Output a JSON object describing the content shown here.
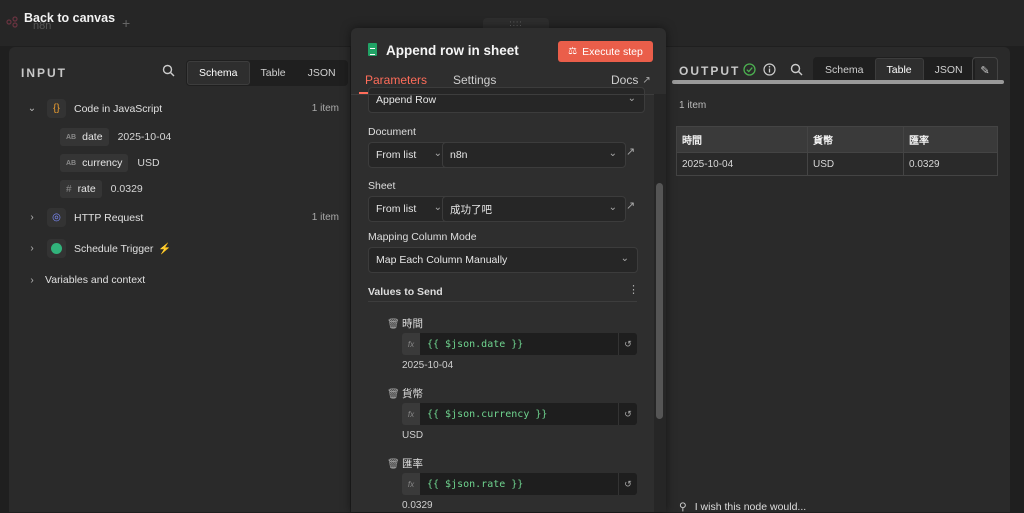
{
  "topbar": {
    "back_label": "Back to canvas",
    "ghost_app_name": "n8n",
    "add_tab_icon": "plus-icon"
  },
  "input": {
    "title": "INPUT",
    "view_tabs": [
      "Schema",
      "Table",
      "JSON"
    ],
    "active_tab": "Schema",
    "nodes": [
      {
        "name": "Code in JavaScript",
        "count": "1 item",
        "icon": "code-braces-icon",
        "expanded": true,
        "fields": [
          {
            "type": "AB",
            "key": "date",
            "value": "2025-10-04"
          },
          {
            "type": "AB",
            "key": "currency",
            "value": "USD"
          },
          {
            "type": "#",
            "key": "rate",
            "value": "0.0329"
          }
        ]
      },
      {
        "name": "HTTP Request",
        "count": "1 item",
        "icon": "globe-icon"
      },
      {
        "name": "Schedule Trigger",
        "icon": "clock-icon",
        "badge_icon": "lightning-icon"
      },
      {
        "name": "Variables and context"
      }
    ]
  },
  "node": {
    "title": "Append row in sheet",
    "execute_label": "Execute step",
    "tabs": {
      "parameters": "Parameters",
      "settings": "Settings",
      "docs": "Docs"
    },
    "operation": "Append Row",
    "document": {
      "label": "Document",
      "mode": "From list",
      "value": "n8n"
    },
    "sheet": {
      "label": "Sheet",
      "mode": "From list",
      "value": "成功了吧"
    },
    "mapping": {
      "label": "Mapping Column Mode",
      "value": "Map Each Column Manually"
    },
    "values_label": "Values to Send",
    "fx_label": "fx",
    "values": [
      {
        "column": "時間",
        "expression": "{{ $json.date }}",
        "result": "2025-10-04"
      },
      {
        "column": "貨幣",
        "expression": "{{ $json.currency }}",
        "result": "USD"
      },
      {
        "column": "匯率",
        "expression": "{{ $json.rate }}",
        "result": "0.0329"
      }
    ]
  },
  "output": {
    "title": "OUTPUT",
    "view_tabs": [
      "Schema",
      "Table",
      "JSON"
    ],
    "active_tab": "Table",
    "count": "1 item",
    "columns": [
      "時間",
      "貨幣",
      "匯率"
    ],
    "rows": [
      [
        "2025-10-04",
        "USD",
        "0.0329"
      ]
    ],
    "feedback": "I wish this node would..."
  },
  "colors": {
    "accent": "#ff6d5a",
    "execute_bg": "#ea5e4a",
    "success": "#4caf50",
    "sheets_green": "#21a366",
    "expression_green": "#6fd48f"
  }
}
